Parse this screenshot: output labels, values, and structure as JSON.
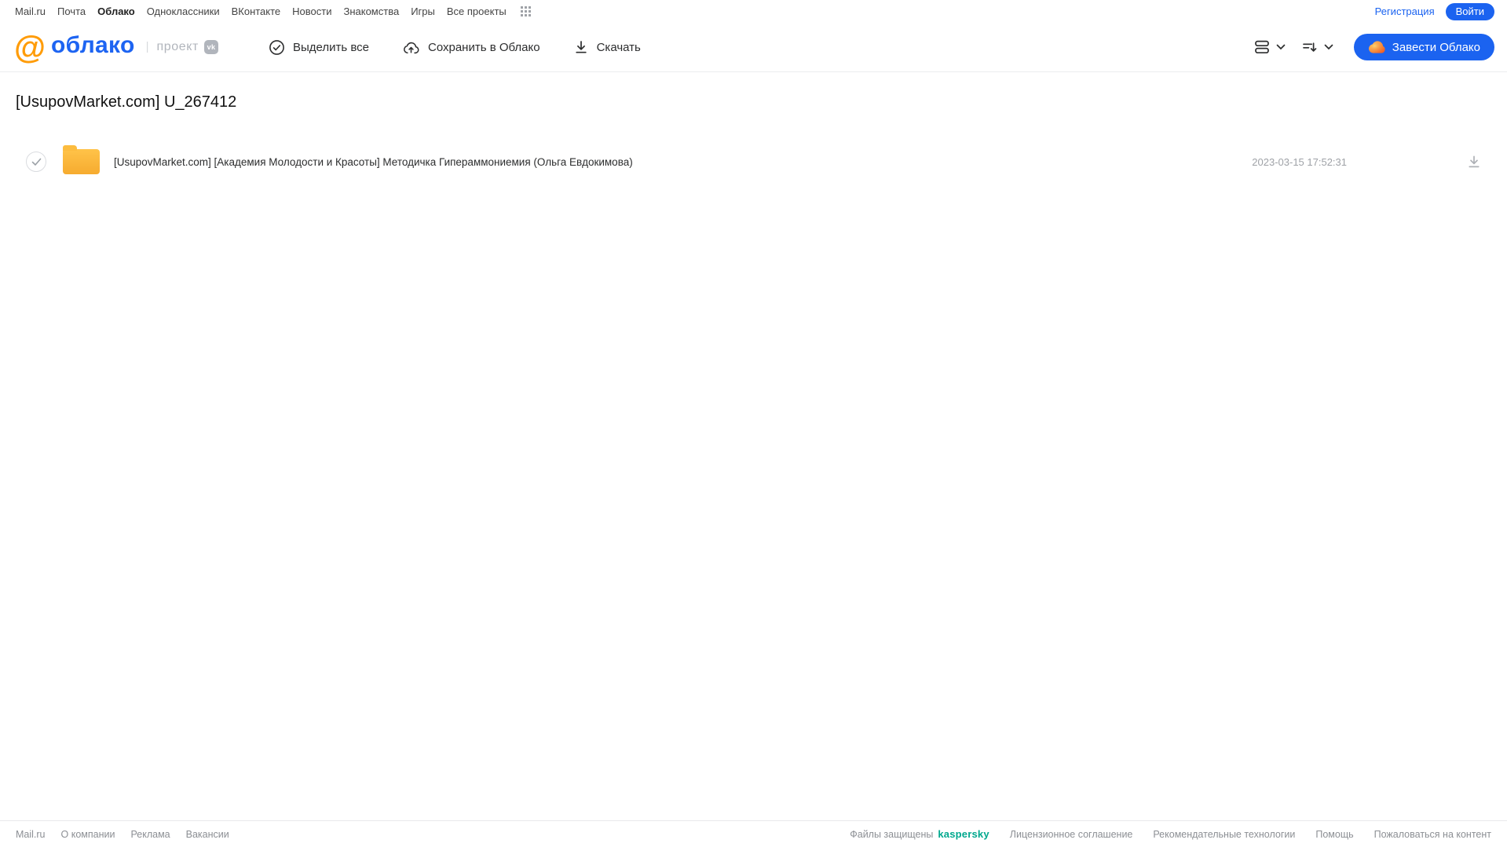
{
  "topnav": {
    "items": [
      "Mail.ru",
      "Почта",
      "Облако",
      "Одноклассники",
      "ВКонтакте",
      "Новости",
      "Знакомства",
      "Игры",
      "Все проекты"
    ],
    "register": "Регистрация",
    "login": "Войти"
  },
  "header": {
    "logo": "облако",
    "project": "проект",
    "vk_badge": "vk",
    "select_all": "Выделить все",
    "save_to_cloud": "Сохранить в Облако",
    "download": "Скачать",
    "get_cloud": "Завести Облако"
  },
  "page": {
    "title": "[UsupovMarket.com] U_267412"
  },
  "files": [
    {
      "type": "folder",
      "name": "[UsupovMarket.com] [Академия Молодости и Красоты] Методичка Гипераммониемия (Ольга Евдокимова)",
      "date": "2023-03-15 17:52:31"
    }
  ],
  "footer": {
    "left_links": [
      "Mail.ru",
      "О компании",
      "Реклама",
      "Вакансии"
    ],
    "protected_prefix": "Файлы защищены",
    "kaspersky": "kaspersky",
    "right_links": [
      "Лицензионное соглашение",
      "Рекомендательные технологии",
      "Помощь",
      "Пожаловаться на контент"
    ]
  },
  "colors": {
    "accent_blue": "#1b63f0",
    "logo_orange": "#ff9c08",
    "logo_blue": "#1d64f2",
    "folder_yellow": "#f6ab2f",
    "kaspersky_teal": "#00a88e"
  }
}
